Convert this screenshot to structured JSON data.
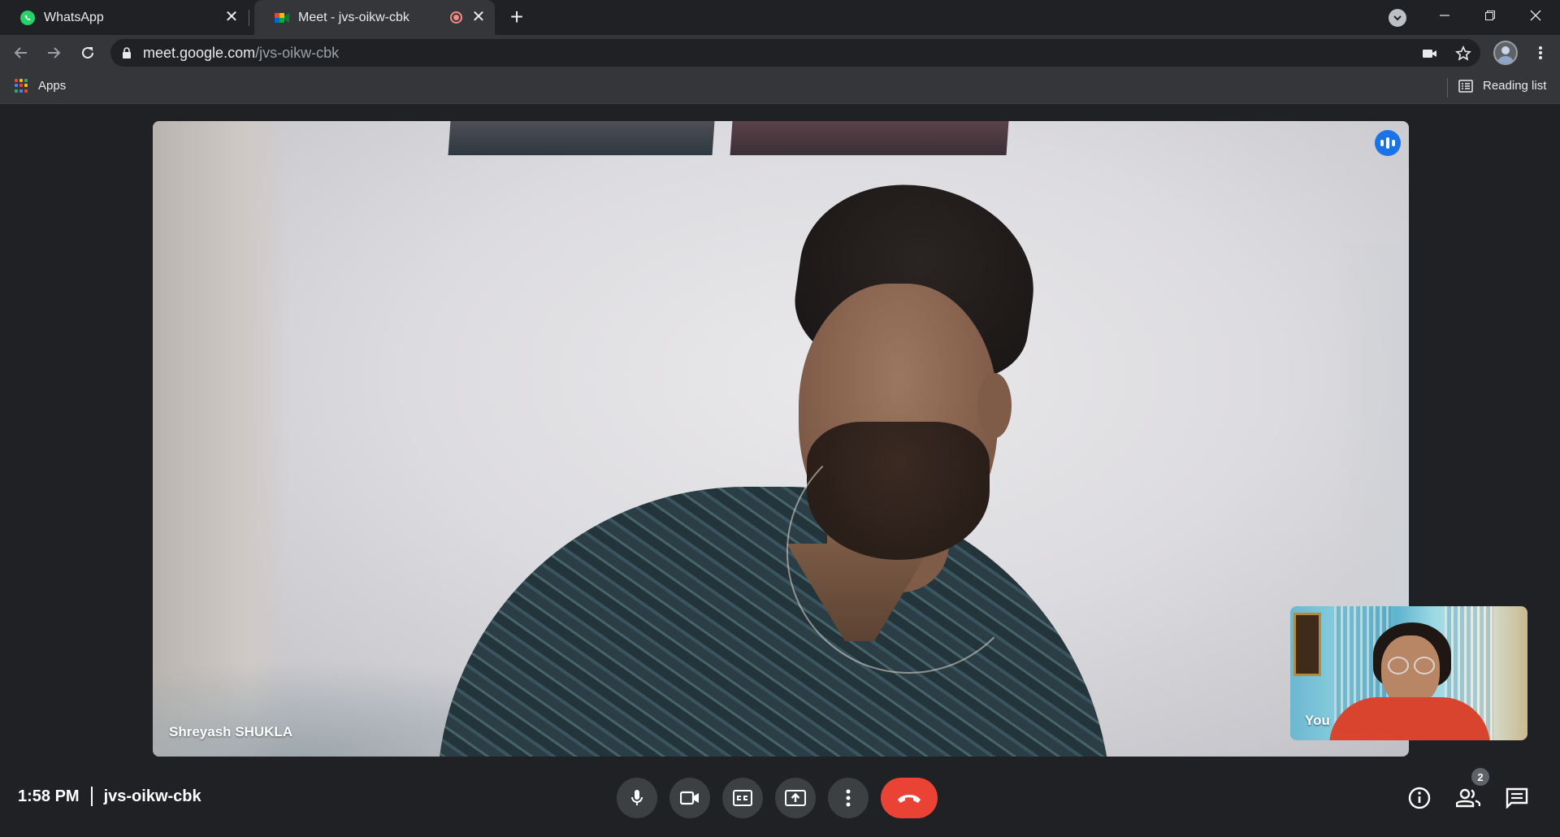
{
  "browser": {
    "tabs": [
      {
        "title": "WhatsApp",
        "active": false
      },
      {
        "title": "Meet - jvs-oikw-cbk",
        "active": true
      }
    ],
    "url_host": "meet.google.com",
    "url_path": "/jvs-oikw-cbk",
    "bookmarks": {
      "apps_label": "Apps",
      "reading_list_label": "Reading list"
    }
  },
  "meet": {
    "main_participant_name": "Shreyash SHUKLA",
    "self_label": "You",
    "time": "1:58 PM",
    "meeting_code": "jvs-oikw-cbk",
    "participant_count": "2",
    "colors": {
      "end_call": "#ea4335",
      "speaking": "#1a73e8",
      "control_bg": "#3c4043"
    },
    "controls": [
      "mic-icon",
      "camera-icon",
      "captions-icon",
      "present-screen-icon",
      "more-options-icon",
      "end-call-icon"
    ],
    "side_controls": [
      "info-icon",
      "people-icon",
      "chat-icon"
    ]
  }
}
